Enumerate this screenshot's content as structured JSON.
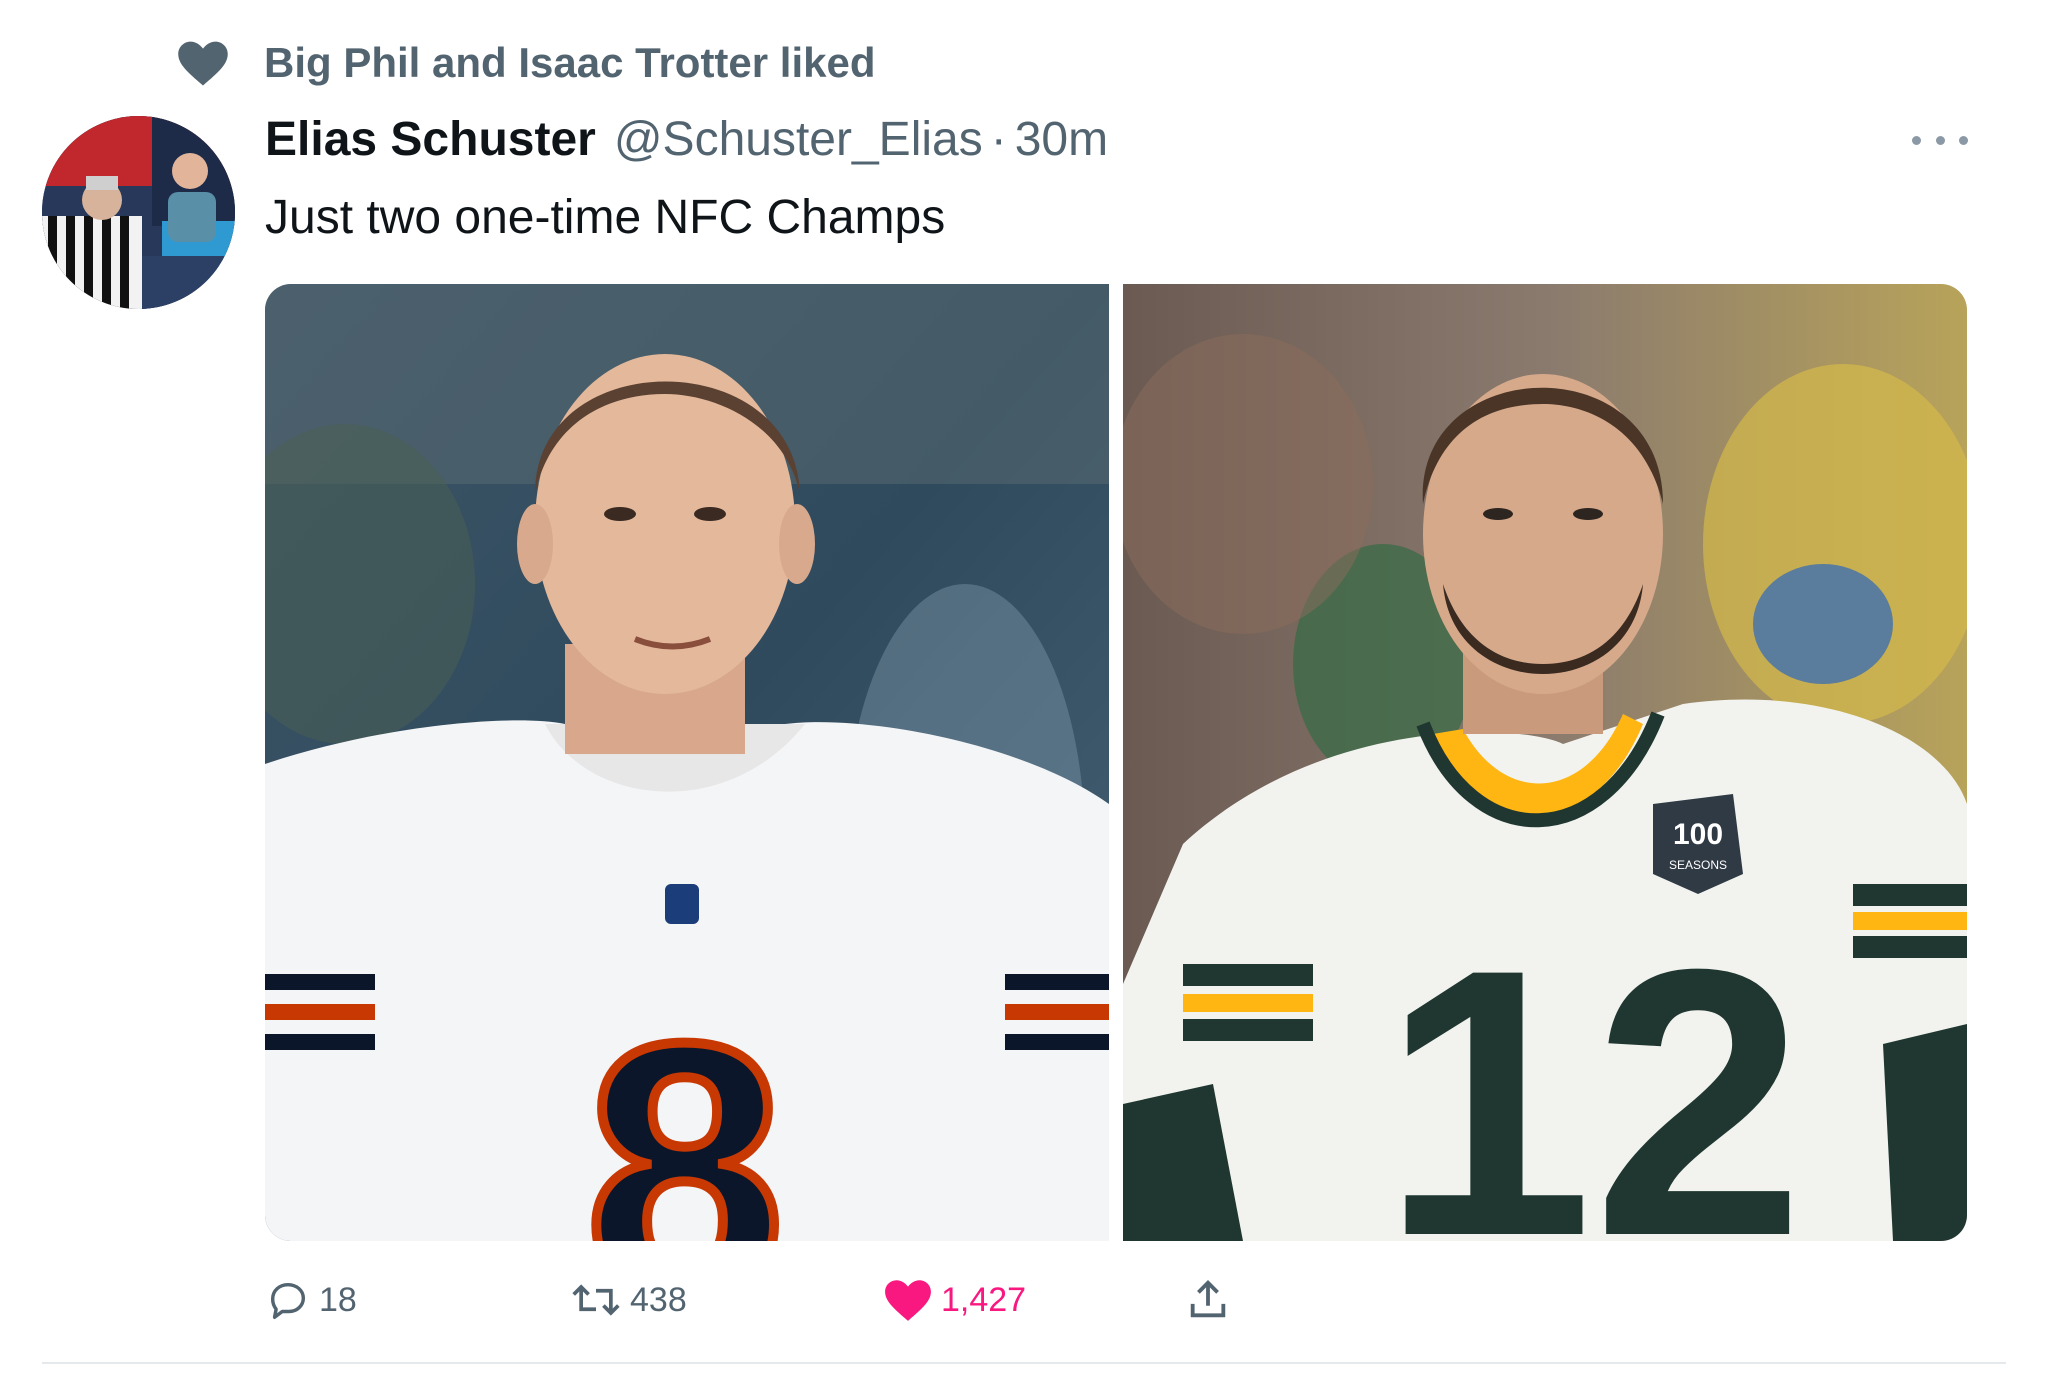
{
  "social_context": {
    "text": "Big Phil and Isaac Trotter liked",
    "icon": "heart-icon"
  },
  "tweet": {
    "author_name": "Elias Schuster",
    "author_handle": "@Schuster_Elias",
    "separator": "·",
    "timestamp": "30m",
    "text": "Just two one-time NFC Champs",
    "media": [
      {
        "description_icon": "player-photo",
        "jersey_number": "8"
      },
      {
        "description_icon": "player-photo",
        "jersey_number": "12",
        "patch": "100",
        "patch_sub": "SEASONS"
      }
    ],
    "actions": {
      "replies": "18",
      "retweets": "438",
      "likes": "1,427"
    }
  },
  "colors": {
    "secondary_text": "#536471",
    "like_pink": "#f91880",
    "bears_navy": "#0b162a",
    "bears_orange": "#c83803",
    "packers_green": "#203731",
    "packers_gold": "#ffb612"
  }
}
